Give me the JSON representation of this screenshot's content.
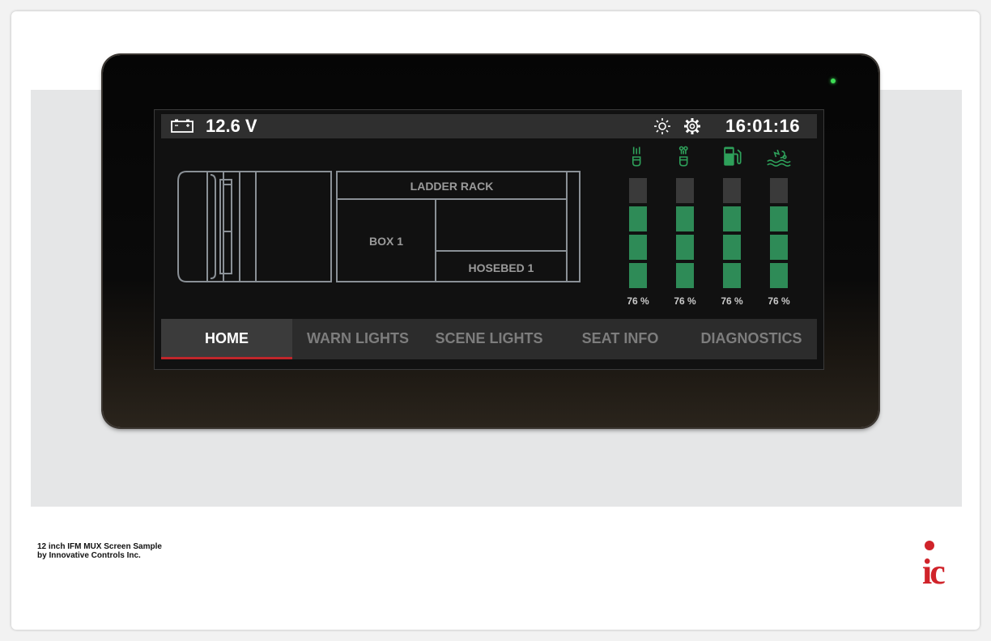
{
  "status": {
    "voltage": "12.6 V",
    "time": "16:01:16"
  },
  "compartments": {
    "ladder_rack": "LADDER RACK",
    "box1": "BOX 1",
    "hosebed1": "HOSEBED 1"
  },
  "gauges": [
    {
      "icon": "water-tank-icon",
      "percent": "76 %",
      "level_segments": 3,
      "total_segments": 4
    },
    {
      "icon": "foam-tank-icon",
      "percent": "76 %",
      "level_segments": 3,
      "total_segments": 4
    },
    {
      "icon": "fuel-pump-icon",
      "percent": "76 %",
      "level_segments": 3,
      "total_segments": 4
    },
    {
      "icon": "def-fluid-icon",
      "percent": "76 %",
      "level_segments": 3,
      "total_segments": 4
    }
  ],
  "tabs": [
    {
      "label": "HOME",
      "active": true
    },
    {
      "label": "WARN LIGHTS",
      "active": false
    },
    {
      "label": "SCENE LIGHTS",
      "active": false
    },
    {
      "label": "SEAT INFO",
      "active": false
    },
    {
      "label": "DIAGNOSTICS",
      "active": false
    }
  ],
  "caption": {
    "line1": "12 inch IFM MUX Screen Sample",
    "line2": "by Innovative Controls Inc."
  },
  "logo_text": "ic",
  "colors": {
    "gauge_green": "#2e8b57",
    "icon_green": "#2ea05a",
    "active_tab_underline": "#c0262b",
    "logo_red": "#d0232a"
  }
}
